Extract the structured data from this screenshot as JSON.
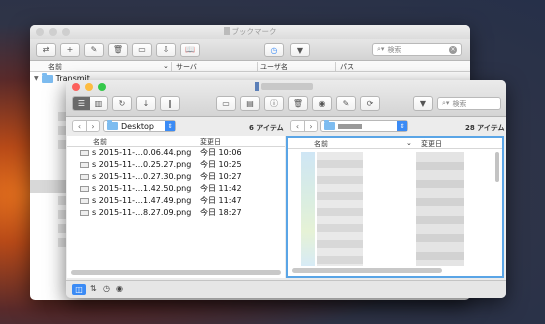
{
  "bookmarks_window": {
    "title": "ブックマーク",
    "search_placeholder": "検索",
    "columns": [
      "名前",
      "サーバ",
      "ユーザ名",
      "パス"
    ],
    "folder": "Transmit"
  },
  "transmit_window": {
    "local_path": "Desktop",
    "local_count": "6 アイテム",
    "remote_count": "28 アイテム",
    "search_placeholder": "検索",
    "columns": {
      "name": "名前",
      "modified": "変更日"
    },
    "files": [
      {
        "name": "s 2015-11-…0.06.44.png",
        "date": "今日 10:06"
      },
      {
        "name": "s 2015-11-…0.25.27.png",
        "date": "今日 10:25"
      },
      {
        "name": "s 2015-11-…0.27.30.png",
        "date": "今日 10:27"
      },
      {
        "name": "s 2015-11-…1.42.50.png",
        "date": "今日 11:42"
      },
      {
        "name": "s 2015-11-…1.47.49.png",
        "date": "今日 11:47"
      },
      {
        "name": "s 2015-11-…8.27.09.png",
        "date": "今日 18:27"
      }
    ]
  },
  "colors": {
    "accent": "#3b8bf5",
    "close": "#fc605c",
    "minimize": "#fdbc40",
    "zoom": "#34c84a"
  }
}
